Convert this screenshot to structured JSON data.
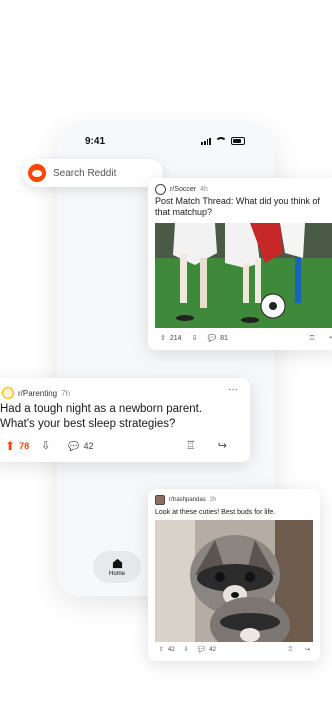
{
  "phone": {
    "time": "9:41"
  },
  "search": {
    "placeholder": "Search Reddit"
  },
  "posts": [
    {
      "subreddit": "r/Soccer",
      "age": "4h",
      "title": "Post Match Thread: What did you think of that matchup?",
      "upvotes": "214",
      "comments": "81"
    },
    {
      "subreddit": "r/Parenting",
      "age": "7h",
      "title": "Had a tough night as a newborn parent. What's your best sleep strategies?",
      "upvotes": "78",
      "comments": "42"
    },
    {
      "subreddit": "r/trashpandas",
      "age": "2h",
      "title": "Look at these cuties! Best buds for life.",
      "upvotes": "42",
      "comments": "42"
    }
  ],
  "nav": {
    "home_label": "Home"
  },
  "colors": {
    "accent": "#ff4500",
    "upvote_active": "#ff4500"
  },
  "icons": [
    "snoo-icon",
    "upvote-icon",
    "downvote-icon",
    "comment-icon",
    "award-icon",
    "share-icon",
    "more-icon",
    "home-icon"
  ]
}
